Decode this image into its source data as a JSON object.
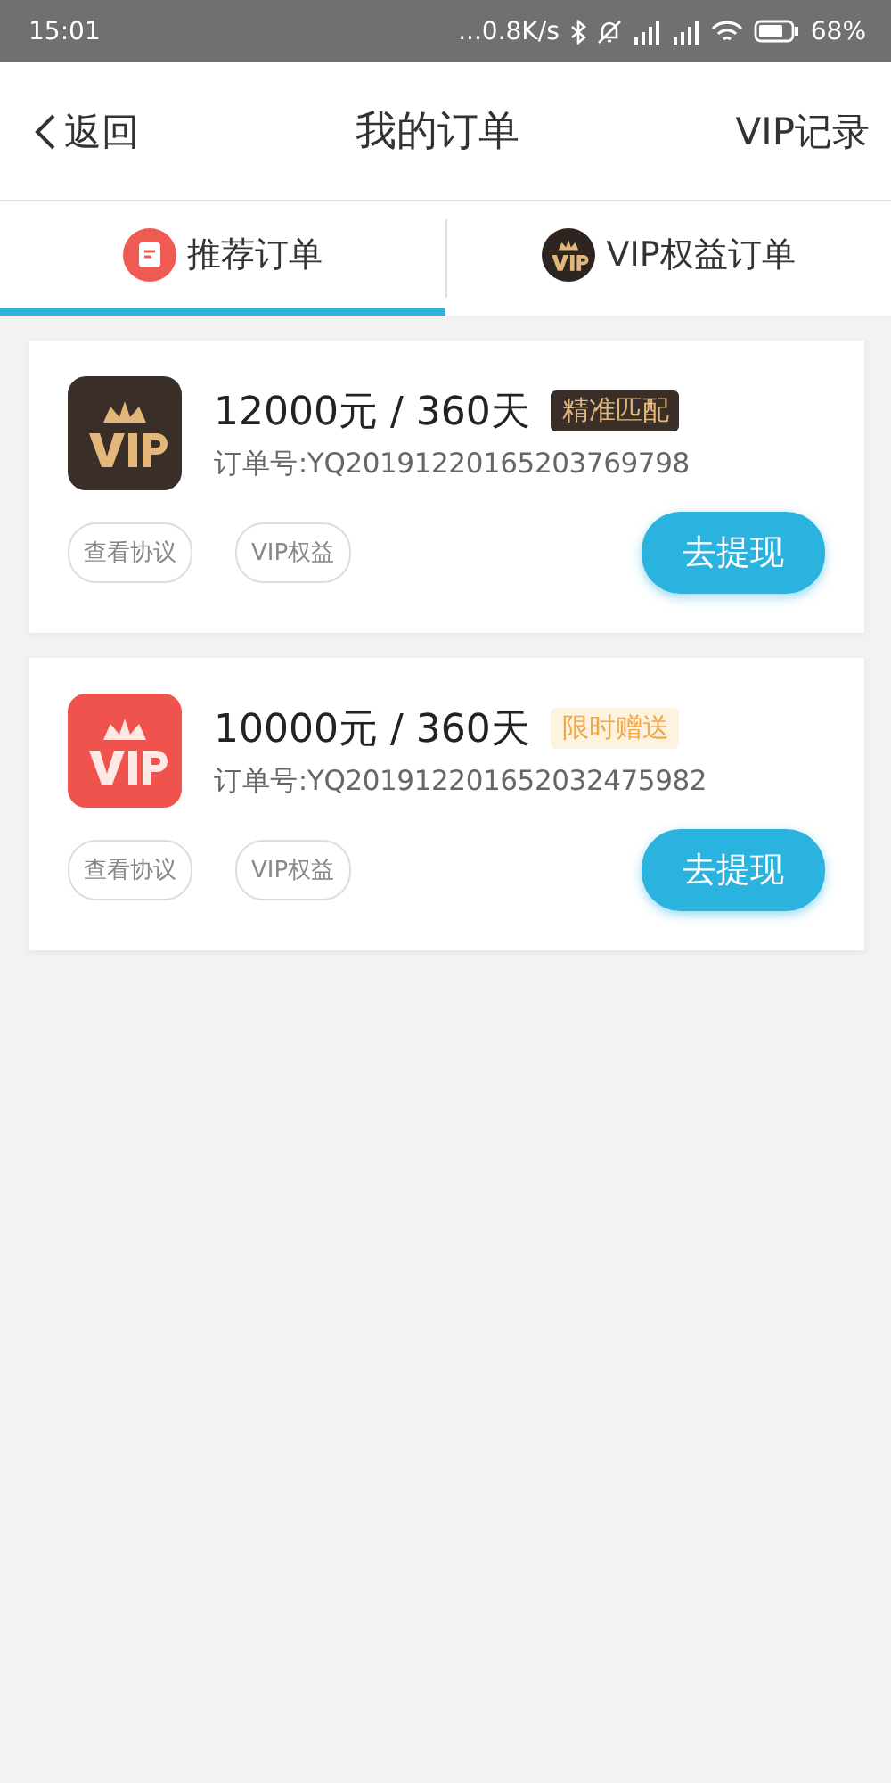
{
  "status_bar": {
    "time": "15:01",
    "network_speed": "...0.8K/s",
    "battery": "68%"
  },
  "header": {
    "back": "返回",
    "title": "我的订单",
    "action": "VIP记录"
  },
  "tabs": [
    {
      "label": "推荐订单",
      "kind": "list",
      "selected": true
    },
    {
      "label": "VIP权益订单",
      "kind": "vip",
      "selected": false
    }
  ],
  "orders": [
    {
      "kind": "dark",
      "amount": "12000元 / 360天",
      "tag": "精准匹配",
      "order_no": "订单号:YQ20191220165203769798",
      "buttons": [
        "查看协议",
        "VIP权益"
      ],
      "action": "去提现"
    },
    {
      "kind": "red",
      "amount": "10000元 / 360天",
      "tag": "限时赠送",
      "order_no": "订单号:YQ201912201652032475982",
      "buttons": [
        "查看协议",
        "VIP权益"
      ],
      "action": "去提现"
    }
  ]
}
